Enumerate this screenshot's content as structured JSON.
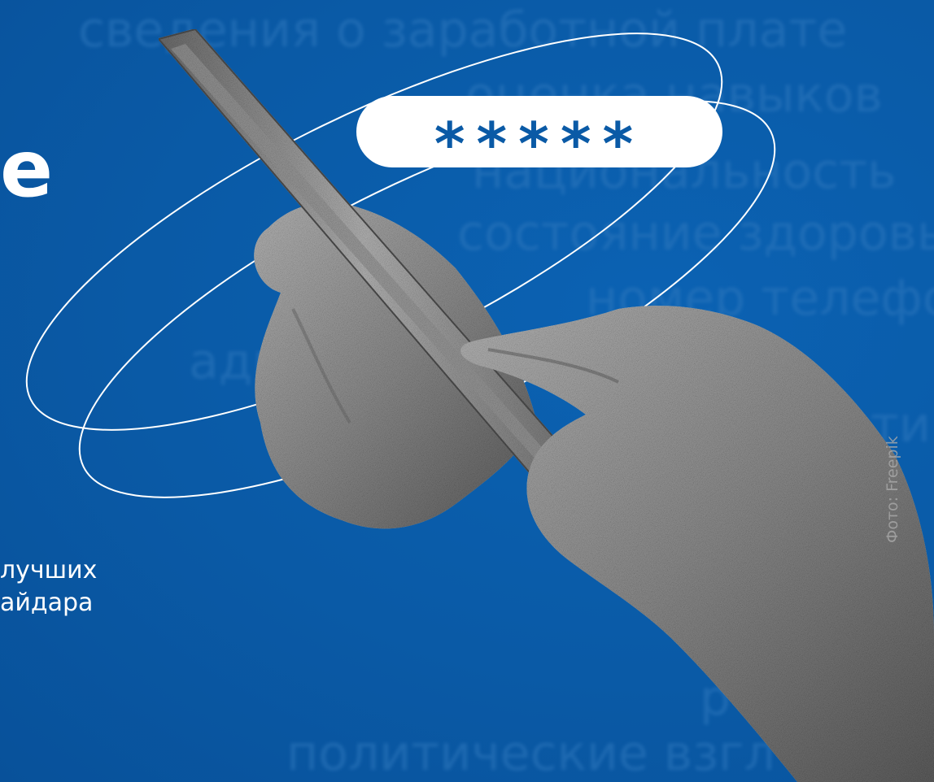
{
  "background_words": [
    "сведения о заработной плате",
    "оценка навыков",
    "национальность",
    "состояние здоровья",
    "номер телефона",
    "адрес почты",
    "сети",
    "р",
    "политические взгл"
  ],
  "headline_fragment": "е",
  "subtitle_lines": [
    "лучших",
    "айдара"
  ],
  "password_mask": "*****",
  "photo_credit": "Фото: Freepik",
  "colors": {
    "background": "#0a5aa6",
    "pill": "#ffffff",
    "mask": "#0a5aa6"
  }
}
